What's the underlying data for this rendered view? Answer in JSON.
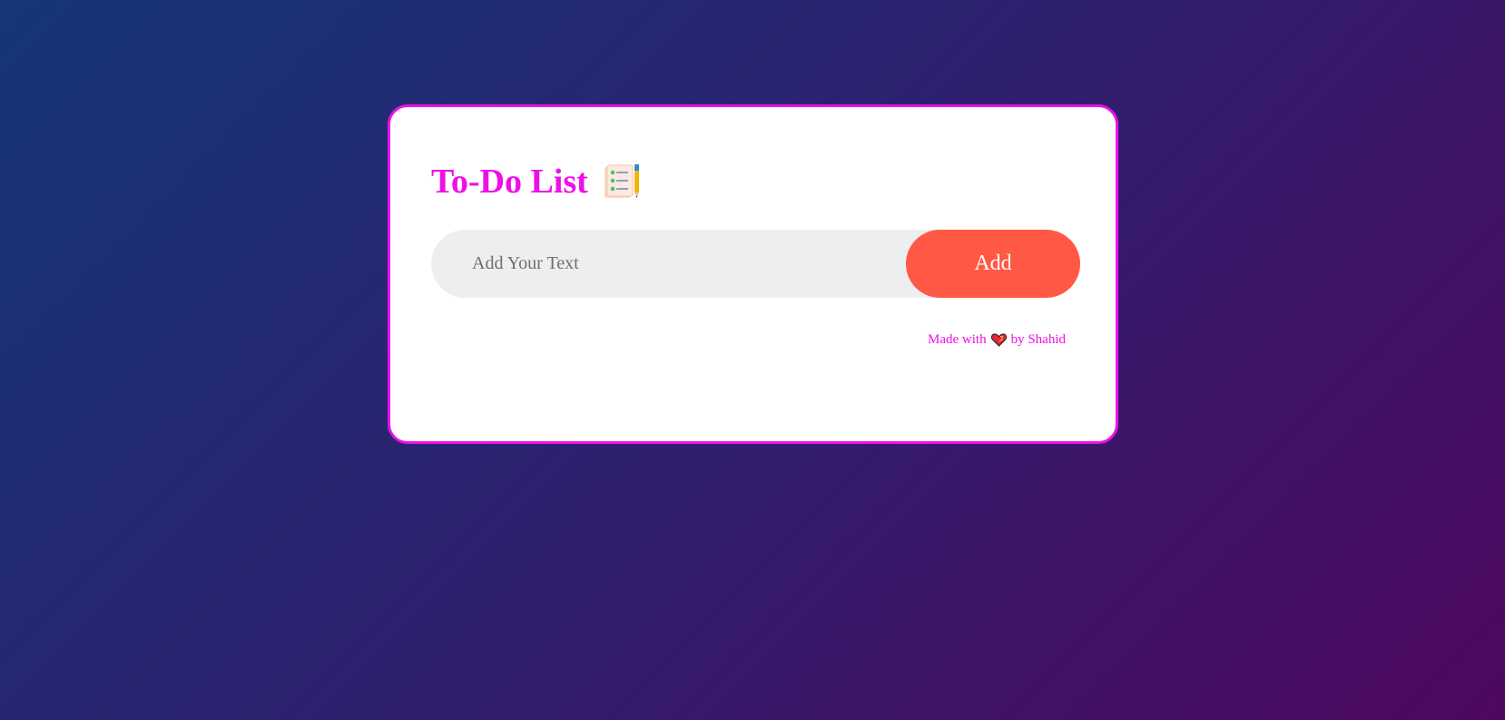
{
  "app": {
    "title": "To-Do List",
    "title_icon": "checklist-notepad-pencil-icon"
  },
  "input": {
    "value": "",
    "placeholder": "Add Your Text"
  },
  "toolbar": {
    "add_label": "Add"
  },
  "footer": {
    "prefix": "Made with",
    "icon": "heart-icon",
    "suffix": "by Shahid"
  },
  "tasks": [],
  "colors": {
    "accent": "#ee10e8",
    "button": "#ff5945",
    "input_bg": "#edeef0",
    "background_start": "#153677",
    "background_end": "#4e085f"
  }
}
